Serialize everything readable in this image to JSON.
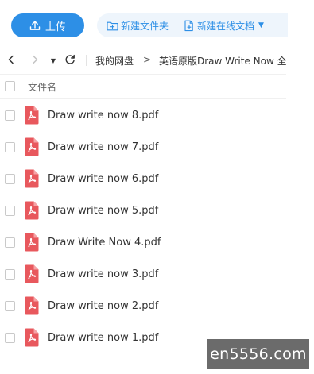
{
  "toolbar": {
    "upload_label": "上传",
    "new_folder_label": "新建文件夹",
    "new_online_doc_label": "新建在线文档",
    "accent_color": "#2d8fe6"
  },
  "nav": {
    "back_icon": "chevron-left-icon",
    "forward_icon": "chevron-right-icon",
    "dropdown_icon": "caret-down-icon",
    "refresh_icon": "refresh-icon",
    "breadcrumb_root": "我的网盘",
    "breadcrumb_separator": ">",
    "breadcrumb_current": "英语原版Draw Write Now 全"
  },
  "list": {
    "column_header": "文件名",
    "file_icon": "pdf-file-icon",
    "pdf_icon_color": "#e8585d",
    "files": [
      {
        "name": "Draw write now 8.pdf"
      },
      {
        "name": "Draw write now 7.pdf"
      },
      {
        "name": "Draw write now 6.pdf"
      },
      {
        "name": "Draw write now 5.pdf"
      },
      {
        "name": "Draw Write Now 4.pdf"
      },
      {
        "name": "Draw write now 3.pdf"
      },
      {
        "name": "Draw write now 2.pdf"
      },
      {
        "name": "Draw write now 1.pdf"
      }
    ]
  },
  "watermark": {
    "text": "en5556.com"
  }
}
